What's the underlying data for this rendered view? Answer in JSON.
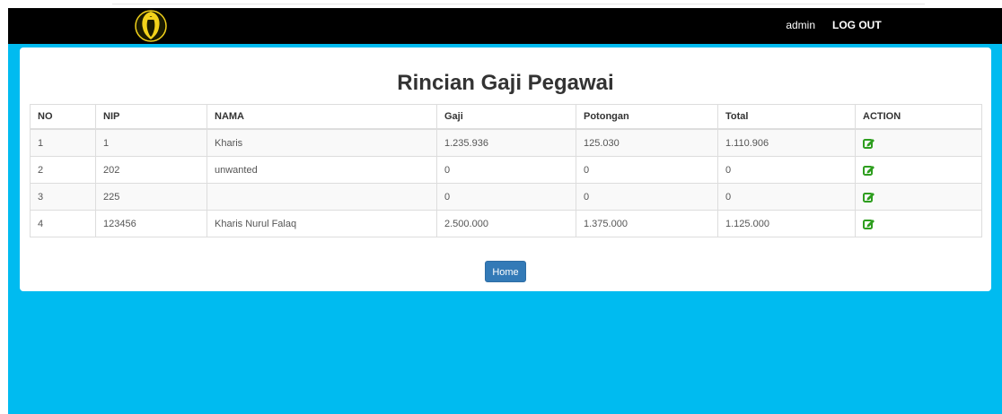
{
  "navbar": {
    "user": "admin",
    "logout_label": "LOG OUT"
  },
  "page": {
    "title": "Rincian Gaji Pegawai",
    "home_label": "Home"
  },
  "table": {
    "headers": [
      "NO",
      "NIP",
      "NAMA",
      "Gaji",
      "Potongan",
      "Total",
      "ACTION"
    ],
    "rows": [
      {
        "no": "1",
        "nip": "1",
        "nama": "Kharis",
        "gaji": "1.235.936",
        "potongan": "125.030",
        "total": "1.110.906"
      },
      {
        "no": "2",
        "nip": "202",
        "nama": "unwanted",
        "gaji": "0",
        "potongan": "0",
        "total": "0"
      },
      {
        "no": "3",
        "nip": "225",
        "nama": "",
        "gaji": "0",
        "potongan": "0",
        "total": "0"
      },
      {
        "no": "4",
        "nip": "123456",
        "nama": "Kharis Nurul Falaq",
        "gaji": "2.500.000",
        "potongan": "1.375.000",
        "total": "1.125.000"
      }
    ]
  },
  "icons": {
    "logo": "emblem-logo",
    "action": "edit-icon"
  },
  "colors": {
    "navbar": "#000000",
    "background": "#00bbf0",
    "button": "#337ab7",
    "edit_icon": "#2e9e1f"
  }
}
